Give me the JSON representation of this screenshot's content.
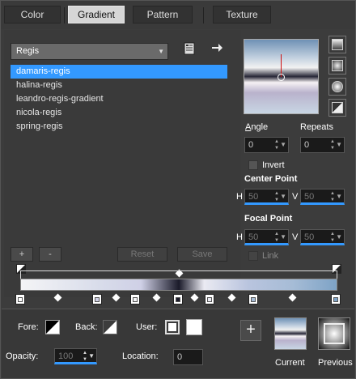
{
  "tabs": [
    {
      "label": "Color"
    },
    {
      "label": "Gradient"
    },
    {
      "label": "Pattern"
    },
    {
      "label": "Texture"
    }
  ],
  "gradient_picker": {
    "selected_category": "Regis",
    "items": [
      "damaris-regis",
      "halina-regis",
      "leandro-regis-gradient",
      "nicola-regis",
      "spring-regis"
    ],
    "selected_index": 0
  },
  "buttons": {
    "add": "+",
    "remove": "-",
    "reset": "Reset",
    "save": "Save"
  },
  "angle": {
    "label": "Angle",
    "value": "0"
  },
  "repeats": {
    "label": "Repeats",
    "value": "0"
  },
  "invert": {
    "label": "Invert",
    "checked": false
  },
  "center_point": {
    "label": "Center Point",
    "h_label": "H",
    "h_value": "50",
    "v_label": "V",
    "v_value": "50"
  },
  "focal_point": {
    "label": "Focal Point",
    "h_label": "H",
    "h_value": "50",
    "v_label": "V",
    "v_value": "50"
  },
  "link": {
    "label": "Link",
    "checked": false
  },
  "stops": {
    "fore_label": "Fore:",
    "back_label": "Back:",
    "user_label": "User:",
    "opacity_label": "Opacity:",
    "opacity_value": "100",
    "location_label": "Location:",
    "location_value": "0"
  },
  "previews": {
    "current_label": "Current",
    "previous_label": "Previous"
  },
  "colors": {
    "accent": "#3399ff",
    "panel": "#3c3c3c"
  },
  "icons": [
    "new-gradient-icon",
    "export-arrow-icon",
    "linear-style-icon",
    "rectangular-style-icon",
    "sunburst-style-icon",
    "radial-style-icon"
  ]
}
